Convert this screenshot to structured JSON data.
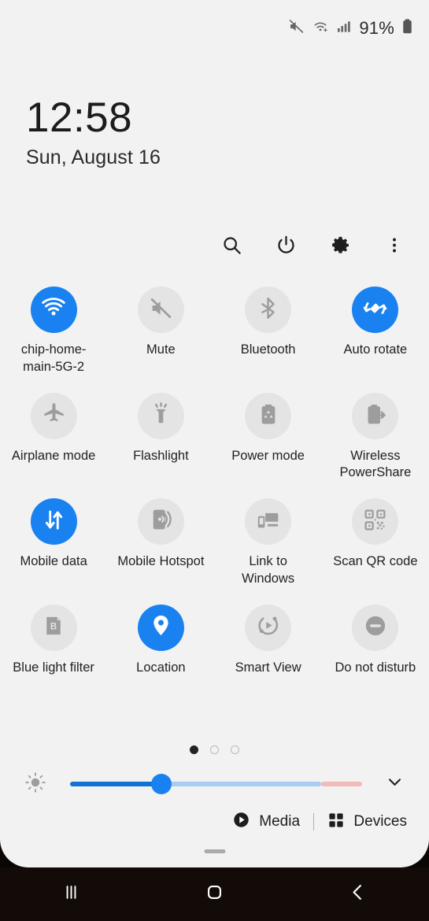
{
  "statusbar": {
    "battery_percent": "91%",
    "icons": [
      "mute-icon",
      "wifi-icon",
      "signal-icon",
      "battery-icon"
    ]
  },
  "clock": {
    "time": "12:58",
    "date": "Sun, August 16"
  },
  "toolbar": {
    "items": [
      {
        "name": "search-icon",
        "label": "Search"
      },
      {
        "name": "power-icon",
        "label": "Power off"
      },
      {
        "name": "gear-icon",
        "label": "Settings"
      },
      {
        "name": "more-options-icon",
        "label": "More options"
      }
    ]
  },
  "tiles": [
    {
      "label": "chip-home-main-5G-2",
      "icon": "wifi-icon",
      "active": true
    },
    {
      "label": "Mute",
      "icon": "mute-icon",
      "active": false
    },
    {
      "label": "Bluetooth",
      "icon": "bluetooth-icon",
      "active": false
    },
    {
      "label": "Auto rotate",
      "icon": "auto-rotate-icon",
      "active": true
    },
    {
      "label": "Airplane mode",
      "icon": "airplane-icon",
      "active": false
    },
    {
      "label": "Flashlight",
      "icon": "flashlight-icon",
      "active": false
    },
    {
      "label": "Power mode",
      "icon": "power-mode-icon",
      "active": false
    },
    {
      "label": "Wireless PowerShare",
      "icon": "wireless-powershare-icon",
      "active": false
    },
    {
      "label": "Mobile data",
      "icon": "mobile-data-icon",
      "active": true
    },
    {
      "label": "Mobile Hotspot",
      "icon": "mobile-hotspot-icon",
      "active": false
    },
    {
      "label": "Link to Windows",
      "icon": "link-to-windows-icon",
      "active": false
    },
    {
      "label": "Scan QR code",
      "icon": "qr-code-icon",
      "active": false
    },
    {
      "label": "Blue light filter",
      "icon": "blue-light-filter-icon",
      "active": false
    },
    {
      "label": "Location",
      "icon": "location-pin-icon",
      "active": true
    },
    {
      "label": "Smart View",
      "icon": "smart-view-icon",
      "active": false
    },
    {
      "label": "Do not disturb",
      "icon": "do-not-disturb-icon",
      "active": false
    }
  ],
  "pager": {
    "total_pages": 3,
    "current_page": 1
  },
  "brightness": {
    "icon": "brightness-sun-icon",
    "value_percent": 28,
    "expand_icon": "chevron-down-icon"
  },
  "bottom_bar": {
    "media_label": "Media",
    "media_icon": "play-circle-icon",
    "devices_label": "Devices",
    "devices_icon": "grid-squares-icon"
  },
  "navbar": {
    "recents_icon": "recents-icon",
    "home_icon": "home-icon",
    "back_icon": "back-icon"
  },
  "colors": {
    "accent_blue": "#1a82f0",
    "panel_background": "#f2f2f2",
    "tile_inactive": "#e4e4e4",
    "icon_inactive": "#9d9d9d",
    "navbar_background": "#130b07"
  }
}
